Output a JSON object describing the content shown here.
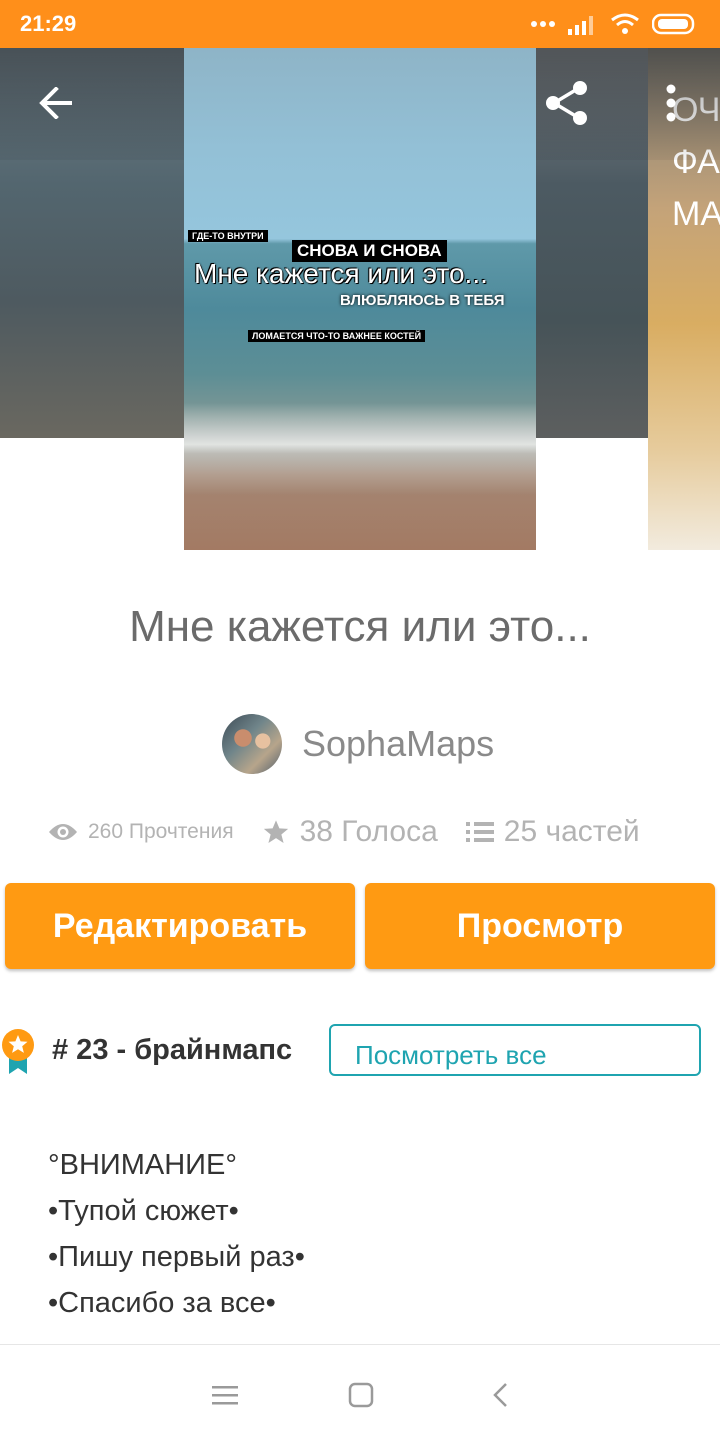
{
  "status_bar": {
    "time": "21:29"
  },
  "cover": {
    "line1": "ГДЕ-ТО ВНУТРИ",
    "line2": "СНОВА И СНОВА",
    "line3": "Мне кажется или это...",
    "line4": "ВЛЮБЛЯЮСЬ В ТЕБЯ",
    "line5": "ЛОМАЕТСЯ ЧТО-ТО ВАЖНЕЕ КОСТЕЙ"
  },
  "next_cover_letters": [
    "ОЧ",
    "ФА",
    "МА"
  ],
  "story": {
    "title": "Мне кажется или это...",
    "author": "SophaMaps",
    "reads": "260 Прочтения",
    "votes": "38 Голоса",
    "parts": "25 частей"
  },
  "actions": {
    "edit_label": "Редактировать",
    "view_label": "Просмотр"
  },
  "ranking": {
    "text": "# 23 - брайнмапс",
    "see_all_label": "Посмотреть все"
  },
  "description": [
    "°ВНИМАНИЕ°",
    "•Тупой сюжет•",
    "•Пишу первый раз•",
    "•Спасибо за все•"
  ],
  "colors": {
    "accent": "#ff9a12",
    "status_bar": "#ff8f1a",
    "link": "#1fa4b0"
  },
  "icons": [
    "back-arrow-icon",
    "share-icon",
    "more-vert-icon",
    "eye-icon",
    "star-icon",
    "list-icon",
    "ribbon-medal-icon",
    "menu-icon",
    "home-square-icon",
    "back-chevron-icon"
  ]
}
